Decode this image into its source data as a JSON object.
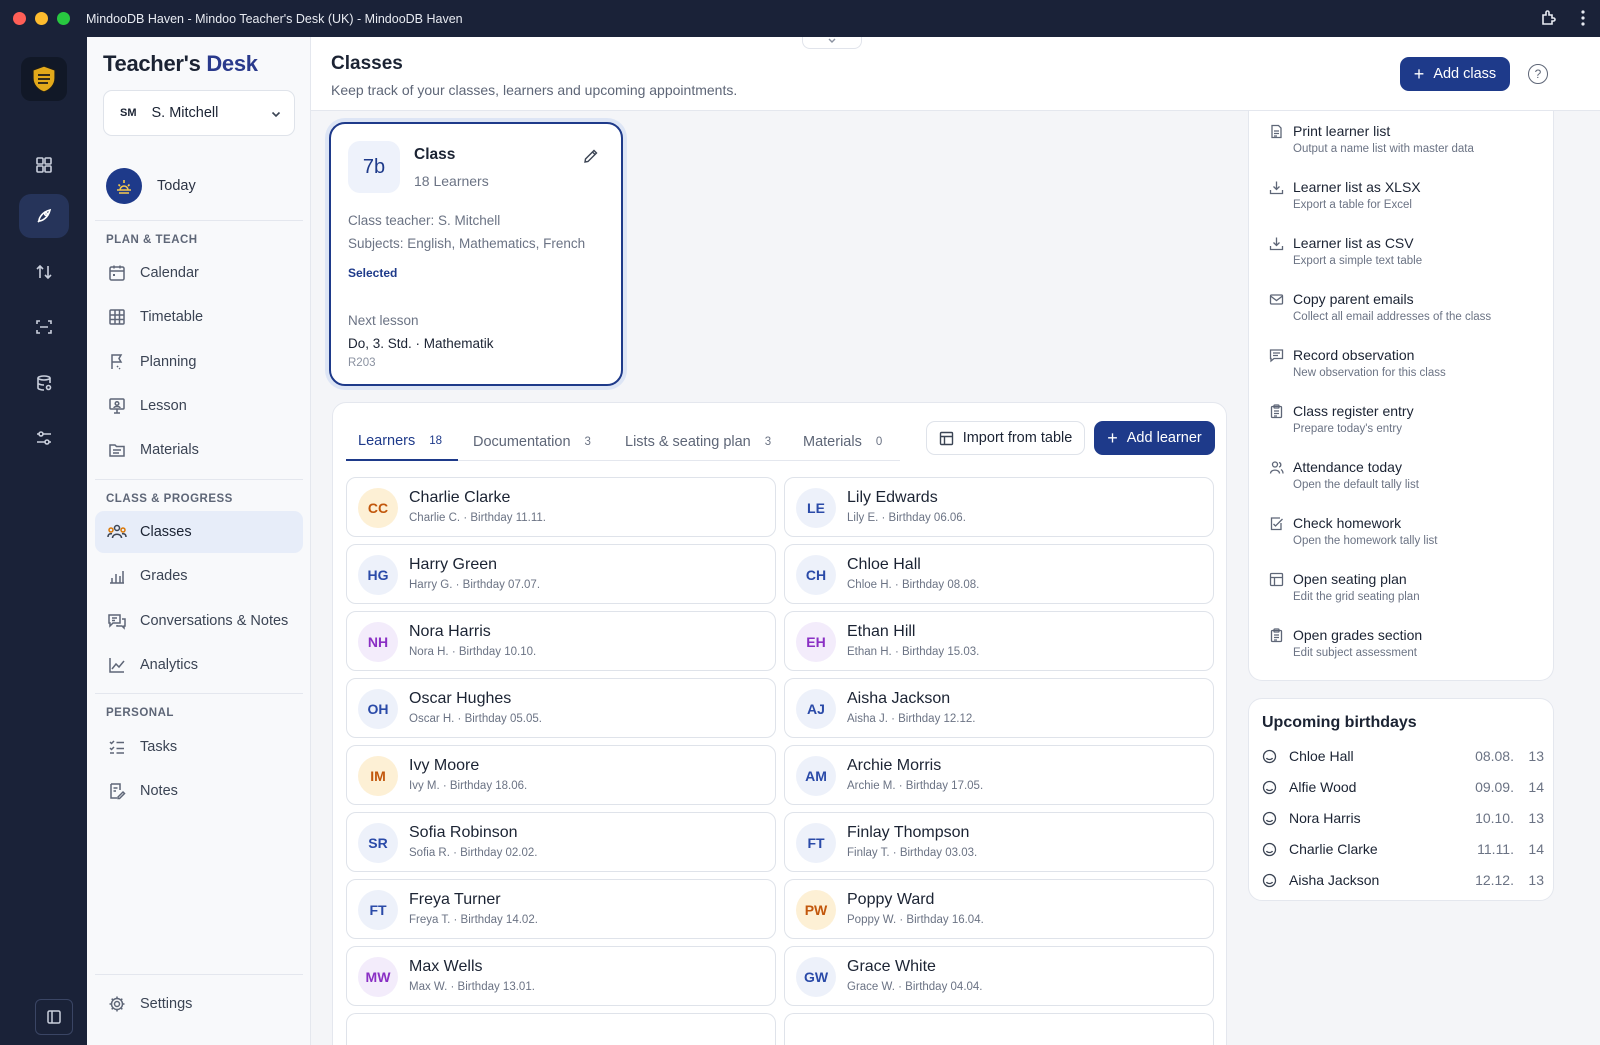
{
  "window": {
    "title": "MindooDB Haven - Mindoo Teacher's Desk (UK) - MindooDB Haven"
  },
  "rail": {
    "items": [
      "dashboard-icon",
      "rocket-icon",
      "sync-icon",
      "scan-icon",
      "database-icon",
      "sliders-icon"
    ]
  },
  "sidebar": {
    "brand_part1": "Teacher's",
    "brand_part2": "Desk",
    "user": {
      "initials": "SM",
      "name": "S. Mitchell"
    },
    "today_label": "Today",
    "sections": {
      "plan_teach": "PLAN & TEACH",
      "class_progress": "CLASS & PROGRESS",
      "personal": "PERSONAL"
    },
    "items": {
      "calendar": "Calendar",
      "timetable": "Timetable",
      "planning": "Planning",
      "lesson": "Lesson",
      "materials": "Materials",
      "classes": "Classes",
      "grades": "Grades",
      "conversations": "Conversations & Notes",
      "analytics": "Analytics",
      "tasks": "Tasks",
      "notes": "Notes",
      "settings": "Settings"
    }
  },
  "header": {
    "title": "Classes",
    "subtitle": "Keep track of your classes, learners and upcoming appointments.",
    "add_class": "Add class",
    "help": "?"
  },
  "class_card": {
    "badge": "7b",
    "title": "Class",
    "count": "18 Learners",
    "teacher": "Class teacher: S. Mitchell",
    "subjects": "Subjects: English, Mathematics, French",
    "status": "Selected",
    "next_label": "Next lesson",
    "next_value": "Do, 3. Std. · Mathematik",
    "room": "R203"
  },
  "tabs": [
    {
      "label": "Learners",
      "count": "18"
    },
    {
      "label": "Documentation",
      "count": "3"
    },
    {
      "label": "Lists & seating plan",
      "count": "3"
    },
    {
      "label": "Materials",
      "count": "0"
    }
  ],
  "buttons": {
    "import": "Import from table",
    "add_learner": "Add learner"
  },
  "learners": [
    {
      "initials": "CC",
      "name": "Charlie Clarke",
      "sub": "Charlie C. · Birthday 11.11.",
      "color": "orange"
    },
    {
      "initials": "LE",
      "name": "Lily Edwards",
      "sub": "Lily E. · Birthday 06.06.",
      "color": "blue"
    },
    {
      "initials": "HG",
      "name": "Harry Green",
      "sub": "Harry G. · Birthday 07.07.",
      "color": "blue"
    },
    {
      "initials": "CH",
      "name": "Chloe Hall",
      "sub": "Chloe H. · Birthday 08.08.",
      "color": "blue"
    },
    {
      "initials": "NH",
      "name": "Nora Harris",
      "sub": "Nora H. · Birthday 10.10.",
      "color": "purple"
    },
    {
      "initials": "EH",
      "name": "Ethan Hill",
      "sub": "Ethan H. · Birthday 15.03.",
      "color": "purple"
    },
    {
      "initials": "OH",
      "name": "Oscar Hughes",
      "sub": "Oscar H. · Birthday 05.05.",
      "color": "blue"
    },
    {
      "initials": "AJ",
      "name": "Aisha Jackson",
      "sub": "Aisha J. · Birthday 12.12.",
      "color": "blue"
    },
    {
      "initials": "IM",
      "name": "Ivy Moore",
      "sub": "Ivy M. · Birthday 18.06.",
      "color": "orange"
    },
    {
      "initials": "AM",
      "name": "Archie Morris",
      "sub": "Archie M. · Birthday 17.05.",
      "color": "blue"
    },
    {
      "initials": "SR",
      "name": "Sofia Robinson",
      "sub": "Sofia R. · Birthday 02.02.",
      "color": "blue"
    },
    {
      "initials": "FT",
      "name": "Finlay Thompson",
      "sub": "Finlay T. · Birthday 03.03.",
      "color": "blue"
    },
    {
      "initials": "FT",
      "name": "Freya Turner",
      "sub": "Freya T. · Birthday 14.02.",
      "color": "blue"
    },
    {
      "initials": "PW",
      "name": "Poppy Ward",
      "sub": "Poppy W. · Birthday 16.04.",
      "color": "orange"
    },
    {
      "initials": "MW",
      "name": "Max Wells",
      "sub": "Max W. · Birthday 13.01.",
      "color": "purple"
    },
    {
      "initials": "GW",
      "name": "Grace White",
      "sub": "Grace W. · Birthday 04.04.",
      "color": "blue"
    }
  ],
  "actions": [
    {
      "icon": "document-icon",
      "title": "Print learner list",
      "sub": "Output a name list with master data"
    },
    {
      "icon": "download-icon",
      "title": "Learner list as XLSX",
      "sub": "Export a table for Excel"
    },
    {
      "icon": "download-icon",
      "title": "Learner list as CSV",
      "sub": "Export a simple text table"
    },
    {
      "icon": "mail-icon",
      "title": "Copy parent emails",
      "sub": "Collect all email addresses of the class"
    },
    {
      "icon": "message-icon",
      "title": "Record observation",
      "sub": "New observation for this class"
    },
    {
      "icon": "clipboard-icon",
      "title": "Class register entry",
      "sub": "Prepare today's entry"
    },
    {
      "icon": "users-icon",
      "title": "Attendance today",
      "sub": "Open the default tally list"
    },
    {
      "icon": "edit-check-icon",
      "title": "Check homework",
      "sub": "Open the homework tally list"
    },
    {
      "icon": "grid-icon",
      "title": "Open seating plan",
      "sub": "Edit the grid seating plan"
    },
    {
      "icon": "clipboard-icon",
      "title": "Open grades section",
      "sub": "Edit subject assessment"
    }
  ],
  "birthdays": {
    "title": "Upcoming birthdays",
    "items": [
      {
        "name": "Chloe Hall",
        "date": "08.08.",
        "age": "13"
      },
      {
        "name": "Alfie Wood",
        "date": "09.09.",
        "age": "14"
      },
      {
        "name": "Nora Harris",
        "date": "10.10.",
        "age": "13"
      },
      {
        "name": "Charlie Clarke",
        "date": "11.11.",
        "age": "14"
      },
      {
        "name": "Aisha Jackson",
        "date": "12.12.",
        "age": "13"
      }
    ]
  }
}
